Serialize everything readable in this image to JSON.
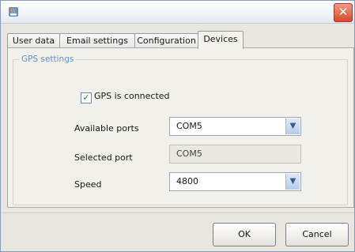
{
  "window": {
    "close_glyph": "✕",
    "app_icon": "java-app-icon"
  },
  "tabs": [
    {
      "label": "User data",
      "active": false
    },
    {
      "label": "Email settings",
      "active": false
    },
    {
      "label": "Configuration",
      "active": false
    },
    {
      "label": "Devices",
      "active": true
    }
  ],
  "gps": {
    "group_title": "GPS settings",
    "connected_label": "GPS is connected",
    "connected_checked": true,
    "available_ports_label": "Available ports",
    "available_ports_value": "COM5",
    "selected_port_label": "Selected port",
    "selected_port_value": "COM5",
    "speed_label": "Speed",
    "speed_value": "4800"
  },
  "buttons": {
    "ok": "OK",
    "cancel": "Cancel"
  },
  "colors": {
    "group_title": "#6b8fbf",
    "close_button": "#d9482a"
  }
}
